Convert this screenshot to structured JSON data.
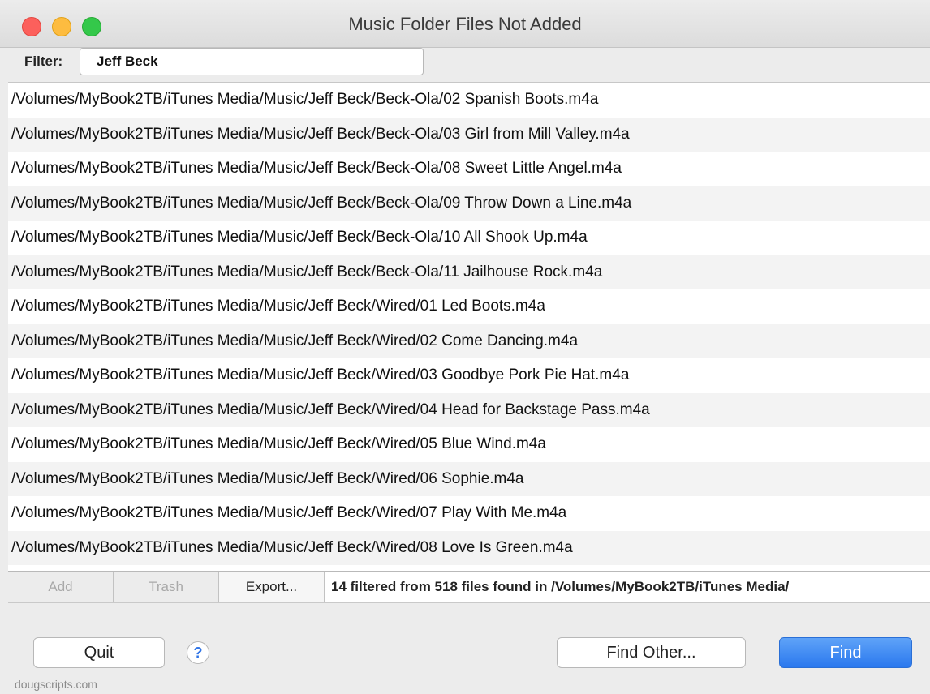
{
  "window": {
    "title": "Music Folder Files Not Added"
  },
  "filter": {
    "label": "Filter:",
    "value": "Jeff Beck"
  },
  "files": [
    "/Volumes/MyBook2TB/iTunes Media/Music/Jeff Beck/Beck-Ola/02 Spanish Boots.m4a",
    "/Volumes/MyBook2TB/iTunes Media/Music/Jeff Beck/Beck-Ola/03 Girl from Mill Valley.m4a",
    "/Volumes/MyBook2TB/iTunes Media/Music/Jeff Beck/Beck-Ola/08 Sweet Little Angel.m4a",
    "/Volumes/MyBook2TB/iTunes Media/Music/Jeff Beck/Beck-Ola/09 Throw Down a Line.m4a",
    "/Volumes/MyBook2TB/iTunes Media/Music/Jeff Beck/Beck-Ola/10 All Shook Up.m4a",
    "/Volumes/MyBook2TB/iTunes Media/Music/Jeff Beck/Beck-Ola/11 Jailhouse Rock.m4a",
    "/Volumes/MyBook2TB/iTunes Media/Music/Jeff Beck/Wired/01 Led Boots.m4a",
    "/Volumes/MyBook2TB/iTunes Media/Music/Jeff Beck/Wired/02 Come Dancing.m4a",
    "/Volumes/MyBook2TB/iTunes Media/Music/Jeff Beck/Wired/03 Goodbye Pork Pie Hat.m4a",
    "/Volumes/MyBook2TB/iTunes Media/Music/Jeff Beck/Wired/04 Head for Backstage Pass.m4a",
    "/Volumes/MyBook2TB/iTunes Media/Music/Jeff Beck/Wired/05 Blue Wind.m4a",
    "/Volumes/MyBook2TB/iTunes Media/Music/Jeff Beck/Wired/06 Sophie.m4a",
    "/Volumes/MyBook2TB/iTunes Media/Music/Jeff Beck/Wired/07 Play With Me.m4a",
    "/Volumes/MyBook2TB/iTunes Media/Music/Jeff Beck/Wired/08 Love Is Green.m4a"
  ],
  "toolbar": {
    "add_label": "Add",
    "trash_label": "Trash",
    "export_label": "Export...",
    "status": "14 filtered from 518 files found in /Volumes/MyBook2TB/iTunes Media/"
  },
  "buttons": {
    "quit_label": "Quit",
    "help_label": "?",
    "find_other_label": "Find Other...",
    "find_label": "Find"
  },
  "footer": {
    "credit": "dougscripts.com"
  },
  "colors": {
    "close": "#fc605c",
    "minimize": "#fdbc40",
    "maximize": "#34c84a",
    "accent": "#2a78ee"
  }
}
